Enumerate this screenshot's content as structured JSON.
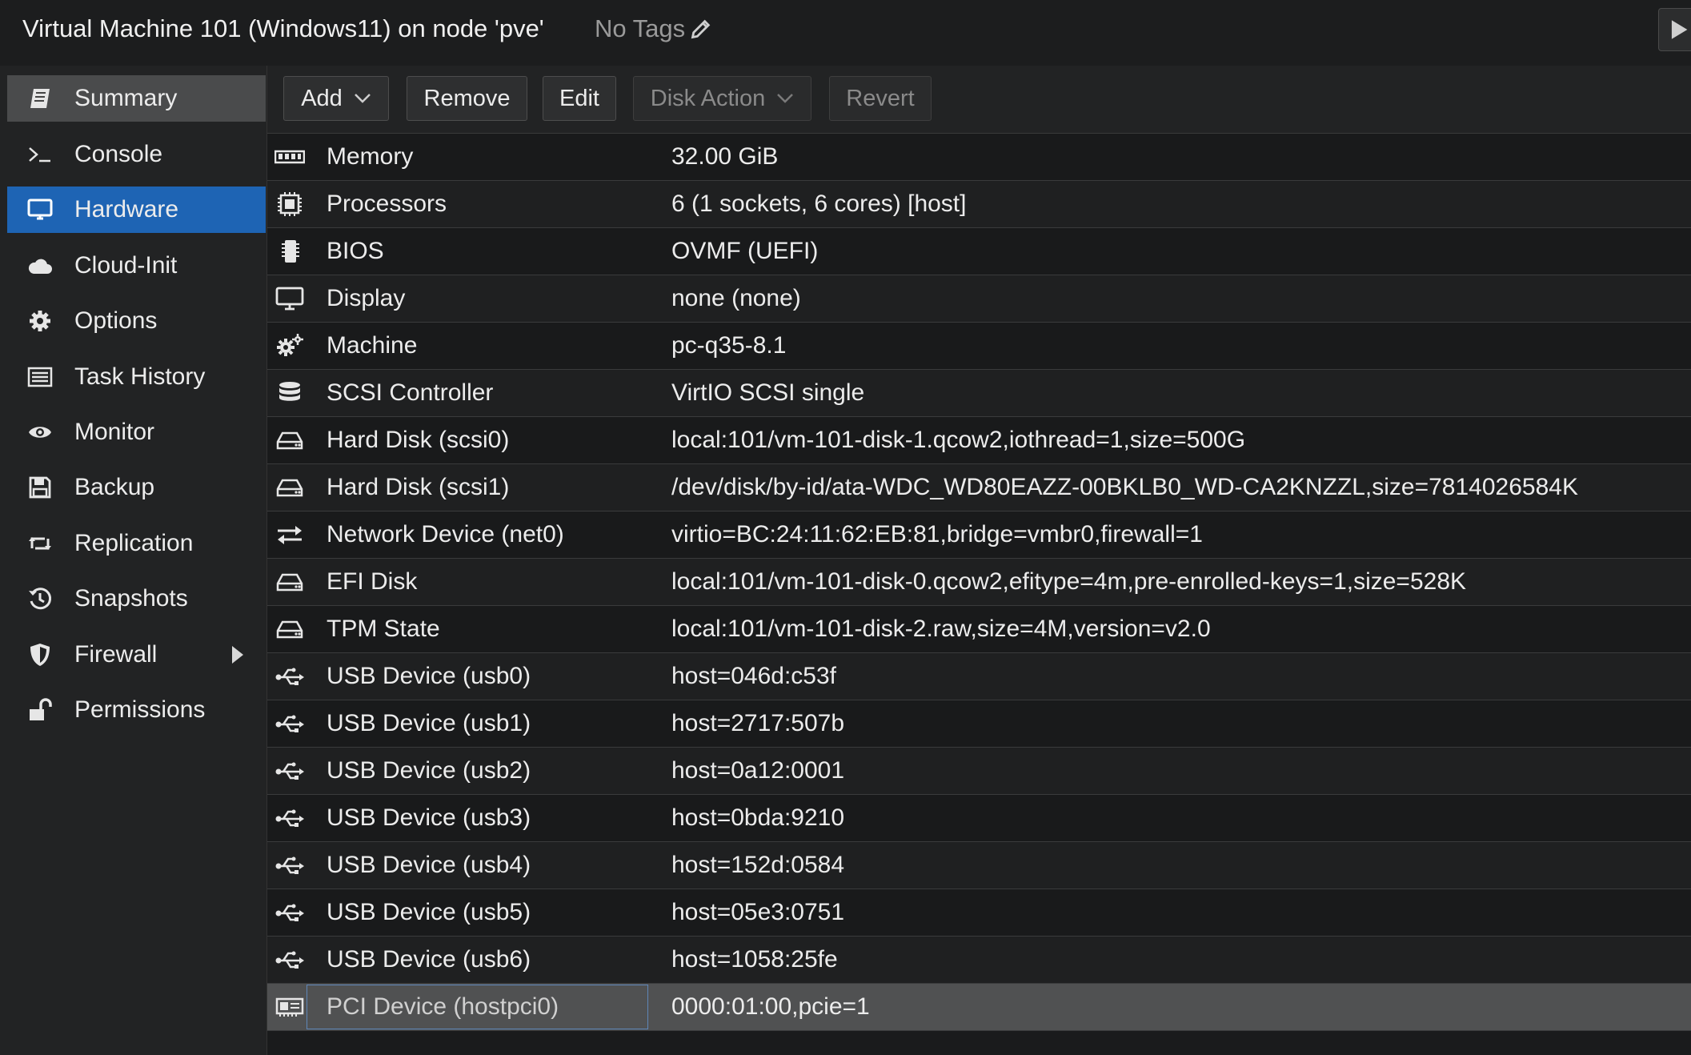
{
  "header": {
    "title": "Virtual Machine 101 (Windows11) on node 'pve'",
    "tags": "No Tags"
  },
  "nav": {
    "items": [
      {
        "label": "Summary",
        "icon": "book-icon"
      },
      {
        "label": "Console",
        "icon": "terminal-icon"
      },
      {
        "label": "Hardware",
        "icon": "desktop-icon"
      },
      {
        "label": "Cloud-Init",
        "icon": "cloud-icon"
      },
      {
        "label": "Options",
        "icon": "gear-icon"
      },
      {
        "label": "Task History",
        "icon": "list-icon"
      },
      {
        "label": "Monitor",
        "icon": "eye-icon"
      },
      {
        "label": "Backup",
        "icon": "floppy-icon"
      },
      {
        "label": "Replication",
        "icon": "retweet-icon"
      },
      {
        "label": "Snapshots",
        "icon": "history-icon"
      },
      {
        "label": "Firewall",
        "icon": "shield-icon"
      },
      {
        "label": "Permissions",
        "icon": "unlock-icon"
      }
    ],
    "active": "Hardware"
  },
  "toolbar": {
    "add": "Add",
    "remove": "Remove",
    "edit": "Edit",
    "disk_action": "Disk Action",
    "revert": "Revert"
  },
  "hardware": [
    {
      "name": "Memory",
      "value": "32.00 GiB",
      "icon": "memory-icon"
    },
    {
      "name": "Processors",
      "value": "6 (1 sockets, 6 cores) [host]",
      "icon": "cpu-icon"
    },
    {
      "name": "BIOS",
      "value": "OVMF (UEFI)",
      "icon": "microchip-icon"
    },
    {
      "name": "Display",
      "value": "none (none)",
      "icon": "desktop-icon"
    },
    {
      "name": "Machine",
      "value": "pc-q35-8.1",
      "icon": "cogs-icon"
    },
    {
      "name": "SCSI Controller",
      "value": "VirtIO SCSI single",
      "icon": "database-icon"
    },
    {
      "name": "Hard Disk (scsi0)",
      "value": "local:101/vm-101-disk-1.qcow2,iothread=1,size=500G",
      "icon": "hdd-icon"
    },
    {
      "name": "Hard Disk (scsi1)",
      "value": "/dev/disk/by-id/ata-WDC_WD80EAZZ-00BKLB0_WD-CA2KNZZL,size=7814026584K",
      "icon": "hdd-icon"
    },
    {
      "name": "Network Device (net0)",
      "value": "virtio=BC:24:11:62:EB:81,bridge=vmbr0,firewall=1",
      "icon": "exchange-icon"
    },
    {
      "name": "EFI Disk",
      "value": "local:101/vm-101-disk-0.qcow2,efitype=4m,pre-enrolled-keys=1,size=528K",
      "icon": "hdd-icon"
    },
    {
      "name": "TPM State",
      "value": "local:101/vm-101-disk-2.raw,size=4M,version=v2.0",
      "icon": "hdd-icon"
    },
    {
      "name": "USB Device (usb0)",
      "value": "host=046d:c53f",
      "icon": "usb-icon"
    },
    {
      "name": "USB Device (usb1)",
      "value": "host=2717:507b",
      "icon": "usb-icon"
    },
    {
      "name": "USB Device (usb2)",
      "value": "host=0a12:0001",
      "icon": "usb-icon"
    },
    {
      "name": "USB Device (usb3)",
      "value": "host=0bda:9210",
      "icon": "usb-icon"
    },
    {
      "name": "USB Device (usb4)",
      "value": "host=152d:0584",
      "icon": "usb-icon"
    },
    {
      "name": "USB Device (usb5)",
      "value": "host=05e3:0751",
      "icon": "usb-icon"
    },
    {
      "name": "USB Device (usb6)",
      "value": "host=1058:25fe",
      "icon": "usb-icon"
    },
    {
      "name": "PCI Device (hostpci0)",
      "value": "0000:01:00,pcie=1",
      "icon": "pci-card-icon"
    }
  ],
  "selected_row": "PCI Device (hostpci0)",
  "colors": {
    "accent": "#1e64b4",
    "background": "#1a1b1c",
    "text": "#ececec"
  }
}
